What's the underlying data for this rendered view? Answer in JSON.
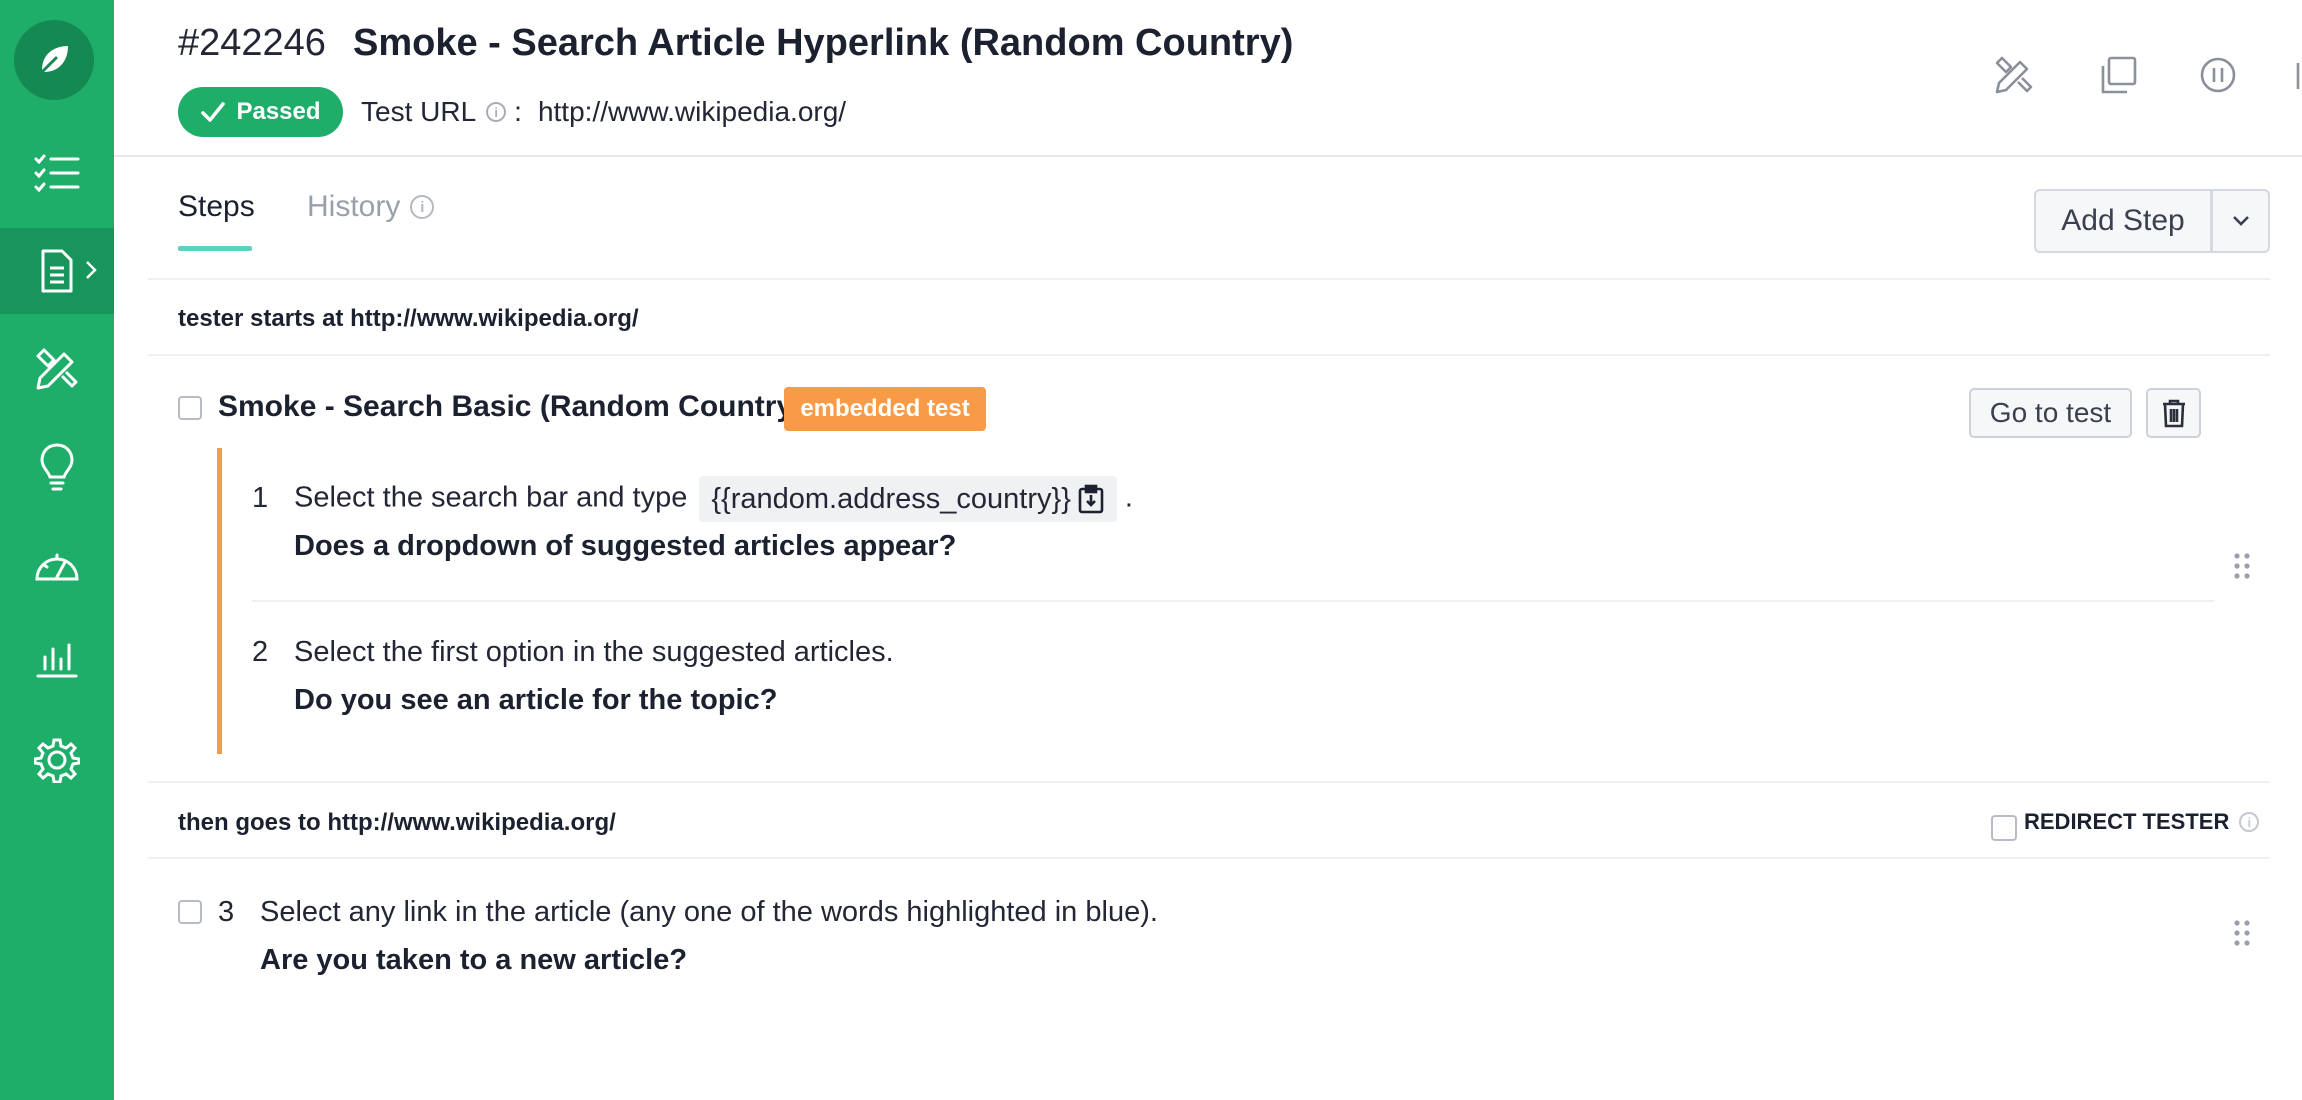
{
  "header": {
    "test_id": "#242246",
    "title": "Smoke - Search Article Hyperlink (Random Country)",
    "status": "Passed",
    "test_url_label": "Test URL",
    "test_url_separator": ":",
    "test_url": "http://www.wikipedia.org/"
  },
  "sidebar": {
    "items": [
      {
        "icon": "checklist-icon"
      },
      {
        "icon": "document-icon",
        "active": true
      },
      {
        "icon": "design-tools-icon"
      },
      {
        "icon": "lightbulb-icon"
      },
      {
        "icon": "speedometer-icon"
      },
      {
        "icon": "bar-chart-icon"
      },
      {
        "icon": "gear-icon"
      }
    ]
  },
  "tabs": {
    "steps": "Steps",
    "history": "History"
  },
  "toolbar": {
    "add_step": "Add Step"
  },
  "flow": {
    "start_line": "tester starts at http://www.wikipedia.org/",
    "then_line": "then goes to http://www.wikipedia.org/",
    "redirect_label": "REDIRECT TESTER"
  },
  "embedded": {
    "title": "Smoke - Search Basic (Random Country)",
    "badge": "embedded test",
    "go_to_test": "Go to test",
    "steps": [
      {
        "number": "1",
        "text": "Select the search bar and type",
        "variable": "{{random.address_country}}",
        "suffix": ".",
        "question": "Does a dropdown of suggested articles appear?"
      },
      {
        "number": "2",
        "text": "Select the first option in the suggested articles.",
        "question": "Do you see an article for the topic?"
      }
    ]
  },
  "steps": [
    {
      "number": "3",
      "text": "Select any link in the article (any one of the words highlighted in blue).",
      "question": "Are you taken to a new article?"
    }
  ],
  "colors": {
    "sidebar": "#1fae6a",
    "accent_orange": "#f99a47",
    "tab_underline": "#5fd0c0"
  }
}
